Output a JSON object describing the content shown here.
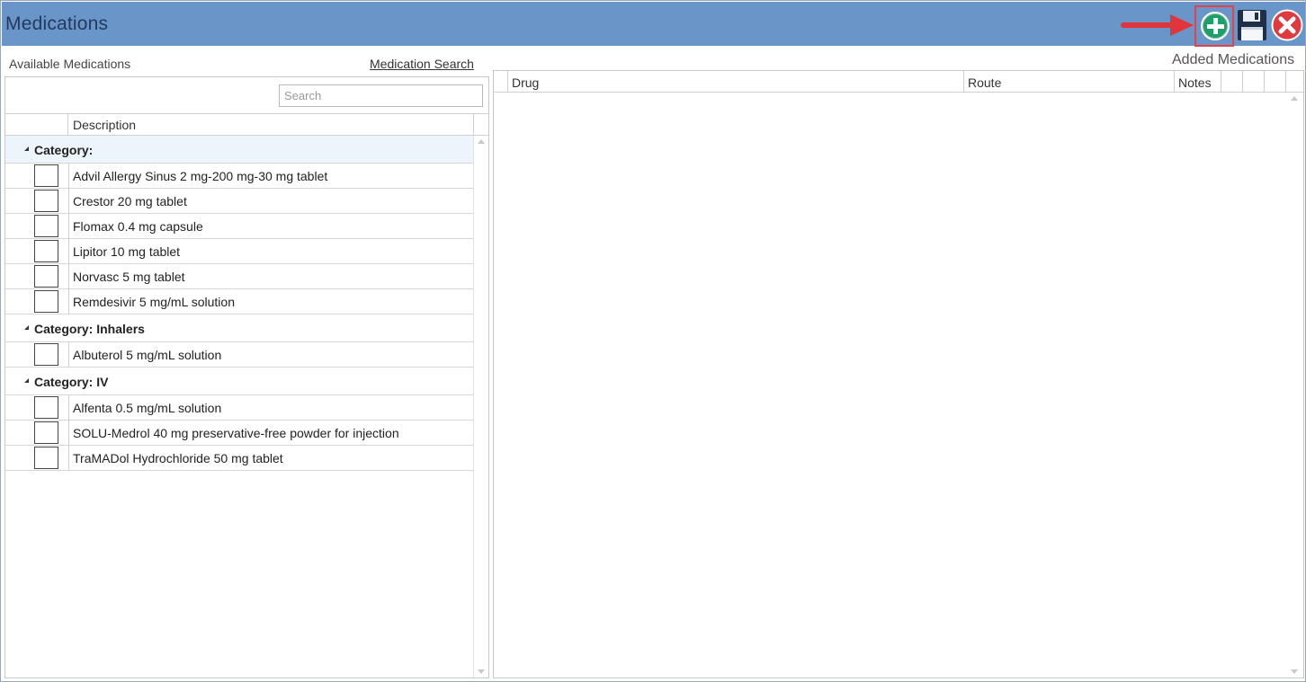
{
  "window": {
    "title": "Medications"
  },
  "toolbar": {
    "add_icon": "plus-circle-icon",
    "save_icon": "floppy-disk-icon",
    "close_icon": "close-circle-icon",
    "colors": {
      "titlebar": "#6a95c9",
      "add": "#1f9e6c",
      "close": "#e03a3e",
      "highlight": "#e0434a"
    }
  },
  "left": {
    "label": "Available Medications",
    "search_link": "Medication Search",
    "search_placeholder": "Search",
    "columns": {
      "description": "Description"
    },
    "groups": [
      {
        "label": "Category:",
        "items": [
          "Advil Allergy Sinus 2 mg-200 mg-30 mg tablet",
          "Crestor 20 mg tablet",
          "Flomax 0.4 mg capsule",
          "Lipitor 10 mg tablet",
          "Norvasc 5 mg tablet",
          "Remdesivir 5 mg/mL solution"
        ]
      },
      {
        "label": "Category: Inhalers",
        "items": [
          "Albuterol 5 mg/mL solution"
        ]
      },
      {
        "label": "Category: IV",
        "items": [
          "Alfenta 0.5 mg/mL solution",
          "SOLU-Medrol 40 mg preservative-free powder for injection",
          "TraMADol Hydrochloride 50 mg tablet"
        ]
      }
    ]
  },
  "right": {
    "label": "Added Medications",
    "columns": {
      "drug": "Drug",
      "route": "Route",
      "notes": "Notes"
    }
  }
}
